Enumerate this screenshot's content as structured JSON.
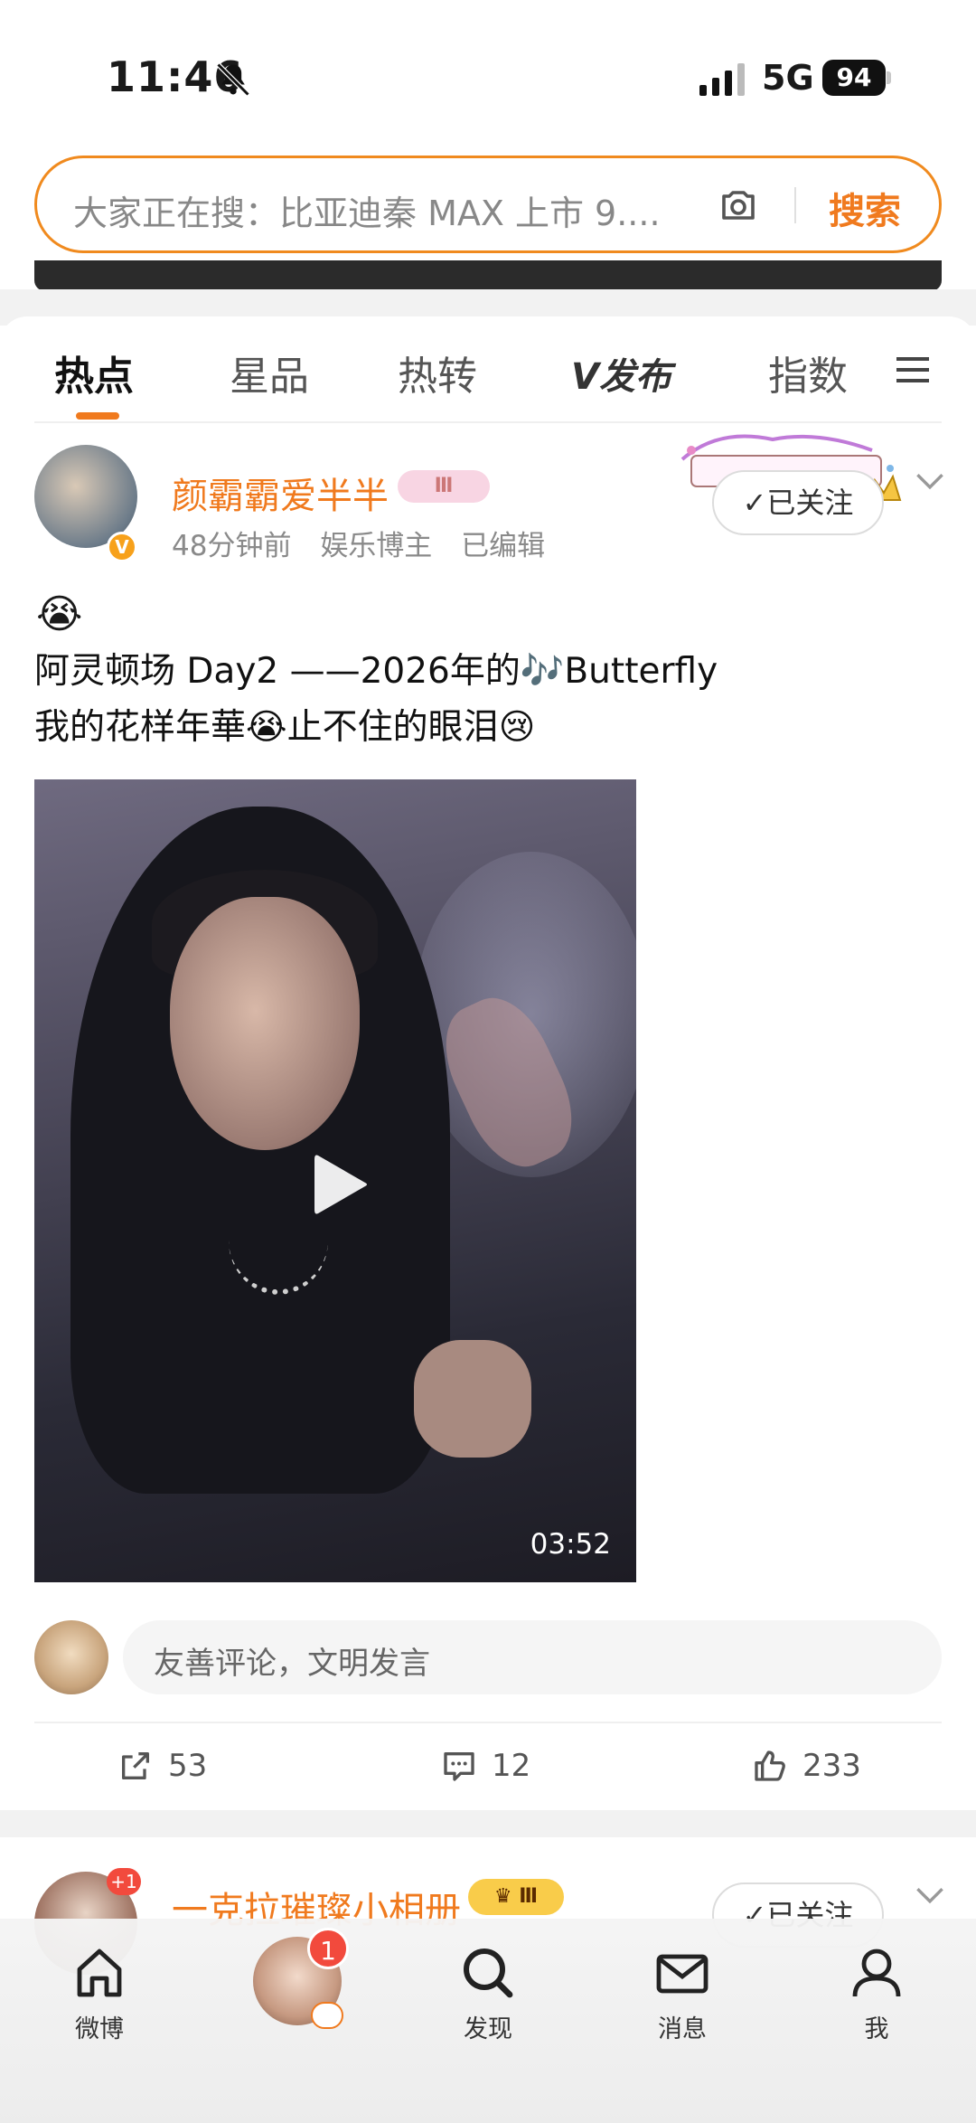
{
  "status_bar": {
    "time": "11:46",
    "network": "5G",
    "battery": "94"
  },
  "search": {
    "placeholder": "大家正在搜：比亚迪秦 MAX 上市 9....",
    "button": "搜索"
  },
  "tabs": [
    {
      "label": "热点",
      "active": true
    },
    {
      "label": "星品",
      "active": false
    },
    {
      "label": "热转",
      "active": false
    },
    {
      "label": "V发布",
      "active": false
    },
    {
      "label": "指数",
      "active": false
    }
  ],
  "post": {
    "username": "颜霸霸爱半半",
    "level_badge": "Ⅲ",
    "time": "48分钟前",
    "category": "娱乐博主",
    "edited": "已编辑",
    "follow": "✓已关注",
    "emoji": "😭",
    "text_line1": "阿灵顿场 Day2 ——2026年的🎶Butterfly",
    "text_line2": "我的花样年華😭止不住的眼泪😢",
    "video_duration": "03:52",
    "comment_placeholder": "友善评论，文明发言",
    "reposts": "53",
    "comments": "12",
    "likes": "233"
  },
  "post2": {
    "username": "一克拉璀璨小相册",
    "badge": "Ⅲ",
    "avatar_badge": "+1",
    "follow": "✓已关注"
  },
  "bottom_nav": {
    "home": "微博",
    "discover": "发现",
    "messages": "消息",
    "me": "我",
    "badge": "1"
  },
  "colors": {
    "accent": "#f07a1e",
    "badge_red": "#f24a3d"
  }
}
